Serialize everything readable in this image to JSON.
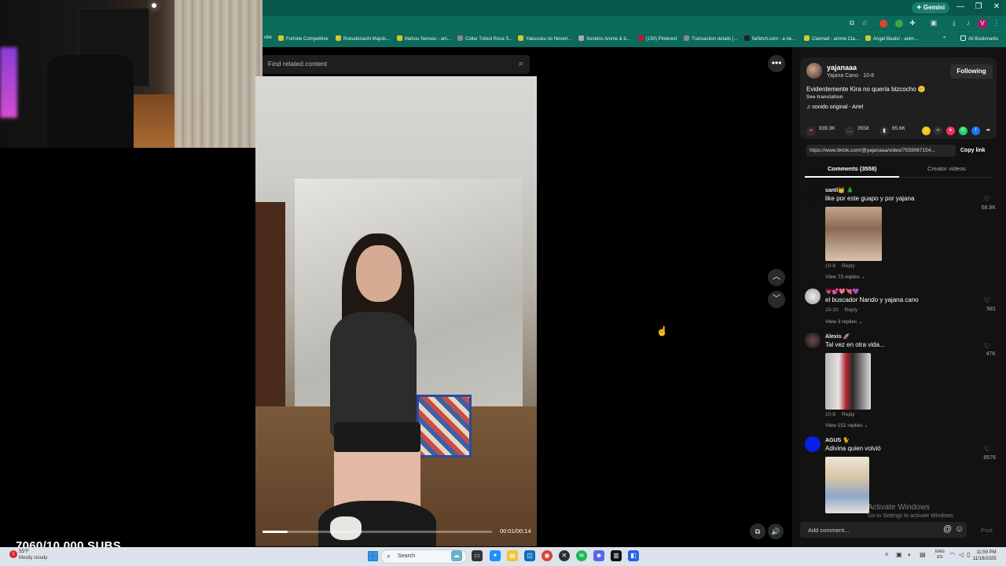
{
  "browser": {
    "gemini_label": "✦ Gemini",
    "window_controls": [
      "—",
      "❐",
      "✕"
    ],
    "bookmarks": [
      {
        "label": "ube",
        "color": "#c33"
      },
      {
        "label": "Fortnite Competitive",
        "color": "#d9c431"
      },
      {
        "label": "Rokudenashi Majuts...",
        "color": "#d9c431"
      },
      {
        "label": "Mahou Sensou - ani...",
        "color": "#d9c431"
      },
      {
        "label": "Collar Trébol Rosa S...",
        "color": "#888"
      },
      {
        "label": "Yakusoku no Neverl...",
        "color": "#d9c431"
      },
      {
        "label": "Sonidos Anime & d...",
        "color": "#aaa"
      },
      {
        "label": "(150) Pinterest",
        "color": "#e60023"
      },
      {
        "label": "Transaction details |...",
        "color": "#888"
      },
      {
        "label": "farfetch.com - a ne...",
        "color": "#222"
      },
      {
        "label": "Clannad - anime Cla...",
        "color": "#d9c431"
      },
      {
        "label": "Angel Beats! - anim...",
        "color": "#d9c431"
      }
    ],
    "all_bookmarks": "All Bookmarks",
    "profile_letter": "V"
  },
  "video": {
    "search_placeholder": "Find related content",
    "time": "00:01/00:14",
    "progress": 0.11
  },
  "overlay": {
    "subs_text": "7060/10.000 SUBS"
  },
  "creator": {
    "username": "yajanaaa",
    "display": "Yajana Cano · 10-8",
    "follow_label": "Following",
    "caption": "Evidentemente Kira no quería bizcocho 🙂",
    "see_translation": "See translation",
    "sound": "♫  sonido original - Ariel"
  },
  "stats": {
    "likes": "939.3K",
    "comments": "3558",
    "saves": "65.6K"
  },
  "link": {
    "url": "https://www.tiktok.com/@yajanaaa/video/7559067154...",
    "copy_label": "Copy link"
  },
  "tabs": {
    "comments": "Comments (3558)",
    "creator_videos": "Creator videos"
  },
  "comments": [
    {
      "name": "santi👑 🎄",
      "text": "like por este guapo y por yajana",
      "date": "10-8",
      "reply": "Reply",
      "replies": "View 73 replies ⌄",
      "likes": "68.9K",
      "avatar_color": "#111",
      "img_color": "#9e7b62"
    },
    {
      "name": "💗💕💖💘💜",
      "text": "el buscador Nando y yajana cano",
      "date": "10-10",
      "reply": "Reply",
      "replies": "View 3 replies ⌄",
      "likes": "581",
      "avatar_color": "#ccc"
    },
    {
      "name": "Alexis 🚀",
      "text": "Tal vez en otra vida...",
      "date": "10-8",
      "reply": "Reply",
      "replies": "View 152 replies ⌄",
      "likes": "47K",
      "avatar_color": "#3a2b2b",
      "img_color": "#c9c6c6"
    },
    {
      "name": "AGUS 🐈",
      "text": "Adivina quien volvió",
      "likes": "8576",
      "avatar_color": "#0a1ee8",
      "img_color": "#d8d0c4"
    }
  ],
  "activate": {
    "title": "Activate Windows",
    "sub": "Go to Settings to activate Windows."
  },
  "composer": {
    "placeholder": "Add comment...",
    "post_label": "Post"
  },
  "taskbar": {
    "temp": "55°F",
    "weather": "Mostly cloudy",
    "search_label": "Search",
    "lang1": "ENG",
    "lang2": "ES",
    "time": "11:59 PM",
    "date": "11/16/2025"
  }
}
